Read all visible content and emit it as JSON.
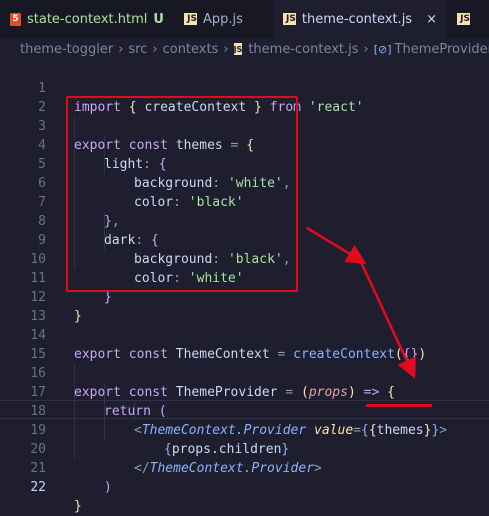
{
  "tabs": [
    {
      "name": "state-context.html",
      "icon": "html5-icon",
      "icon_text": "5",
      "modified": "U"
    },
    {
      "name": "App.js",
      "icon": "js-file-icon",
      "icon_text": "JS"
    },
    {
      "name": "theme-context.js",
      "icon": "js-file-icon",
      "icon_text": "JS",
      "active": true,
      "close": "×"
    },
    {
      "name": "",
      "icon": "js-file-icon",
      "icon_text": "JS"
    }
  ],
  "breadcrumb": {
    "items": [
      "theme-toggler",
      "src",
      "contexts",
      "theme-context.js",
      "ThemeProvider"
    ],
    "separator": "›",
    "file_icon_text": "JS",
    "symbol_icon": "symbol-variable-icon",
    "symbol_icon_text": "[⊘]"
  },
  "line_numbers": [
    "1",
    "2",
    "3",
    "4",
    "5",
    "6",
    "7",
    "8",
    "9",
    "10",
    "11",
    "12",
    "13",
    "14",
    "15",
    "16",
    "17",
    "18",
    "19",
    "20",
    "21",
    "22"
  ],
  "code": {
    "l1": {
      "t1": "import",
      "t2": "{",
      "t3": " createContext ",
      "t4": "}",
      "t5": " from ",
      "t6": "'react'"
    },
    "l3": {
      "t1": "export",
      "t2": " const ",
      "t3": "themes",
      "t4": " = ",
      "t5": "{"
    },
    "l4": {
      "t1": "light",
      "t2": ": ",
      "t3": "{"
    },
    "l5": {
      "t1": "background",
      "t2": ": ",
      "t3": "'white'",
      "t4": ","
    },
    "l6": {
      "t1": "color",
      "t2": ": ",
      "t3": "'black'"
    },
    "l7": {
      "t1": "}",
      "t2": ","
    },
    "l8": {
      "t1": "dark",
      "t2": ": ",
      "t3": "{"
    },
    "l9": {
      "t1": "background",
      "t2": ": ",
      "t3": "'black'",
      "t4": ","
    },
    "l10": {
      "t1": "color",
      "t2": ": ",
      "t3": "'white'"
    },
    "l11": {
      "t1": "}"
    },
    "l12": {
      "t1": "}"
    },
    "l14": {
      "t1": "export",
      "t2": " const ",
      "t3": "ThemeContext",
      "t4": " = ",
      "t5": "createContext",
      "t6": "(",
      "t7": "{}",
      "t8": ")"
    },
    "l16": {
      "t1": "export",
      "t2": " const ",
      "t3": "ThemeProvider",
      "t4": " = ",
      "t5": "(",
      "t6": "props",
      "t7": ")",
      "t8": " => ",
      "t9": "{"
    },
    "l17": {
      "t1": "return",
      "t2": " ("
    },
    "l18": {
      "t1": "<",
      "t2": "ThemeContext.Provider",
      "t3": " value",
      "t4": "=",
      "t5": "{",
      "t6": "{",
      "t7": "themes",
      "t8": "}",
      "t9": "}",
      "t10": ">"
    },
    "l19": {
      "t1": "{",
      "t2": "props.children",
      "t3": "}"
    },
    "l20": {
      "t1": "</",
      "t2": "ThemeContext.Provider",
      "t3": ">"
    },
    "l21": {
      "t1": ")"
    },
    "l22": {
      "t1": "}"
    }
  },
  "colors": {
    "annotation_red": "#e10b1d",
    "background": "#1e1e2e"
  }
}
